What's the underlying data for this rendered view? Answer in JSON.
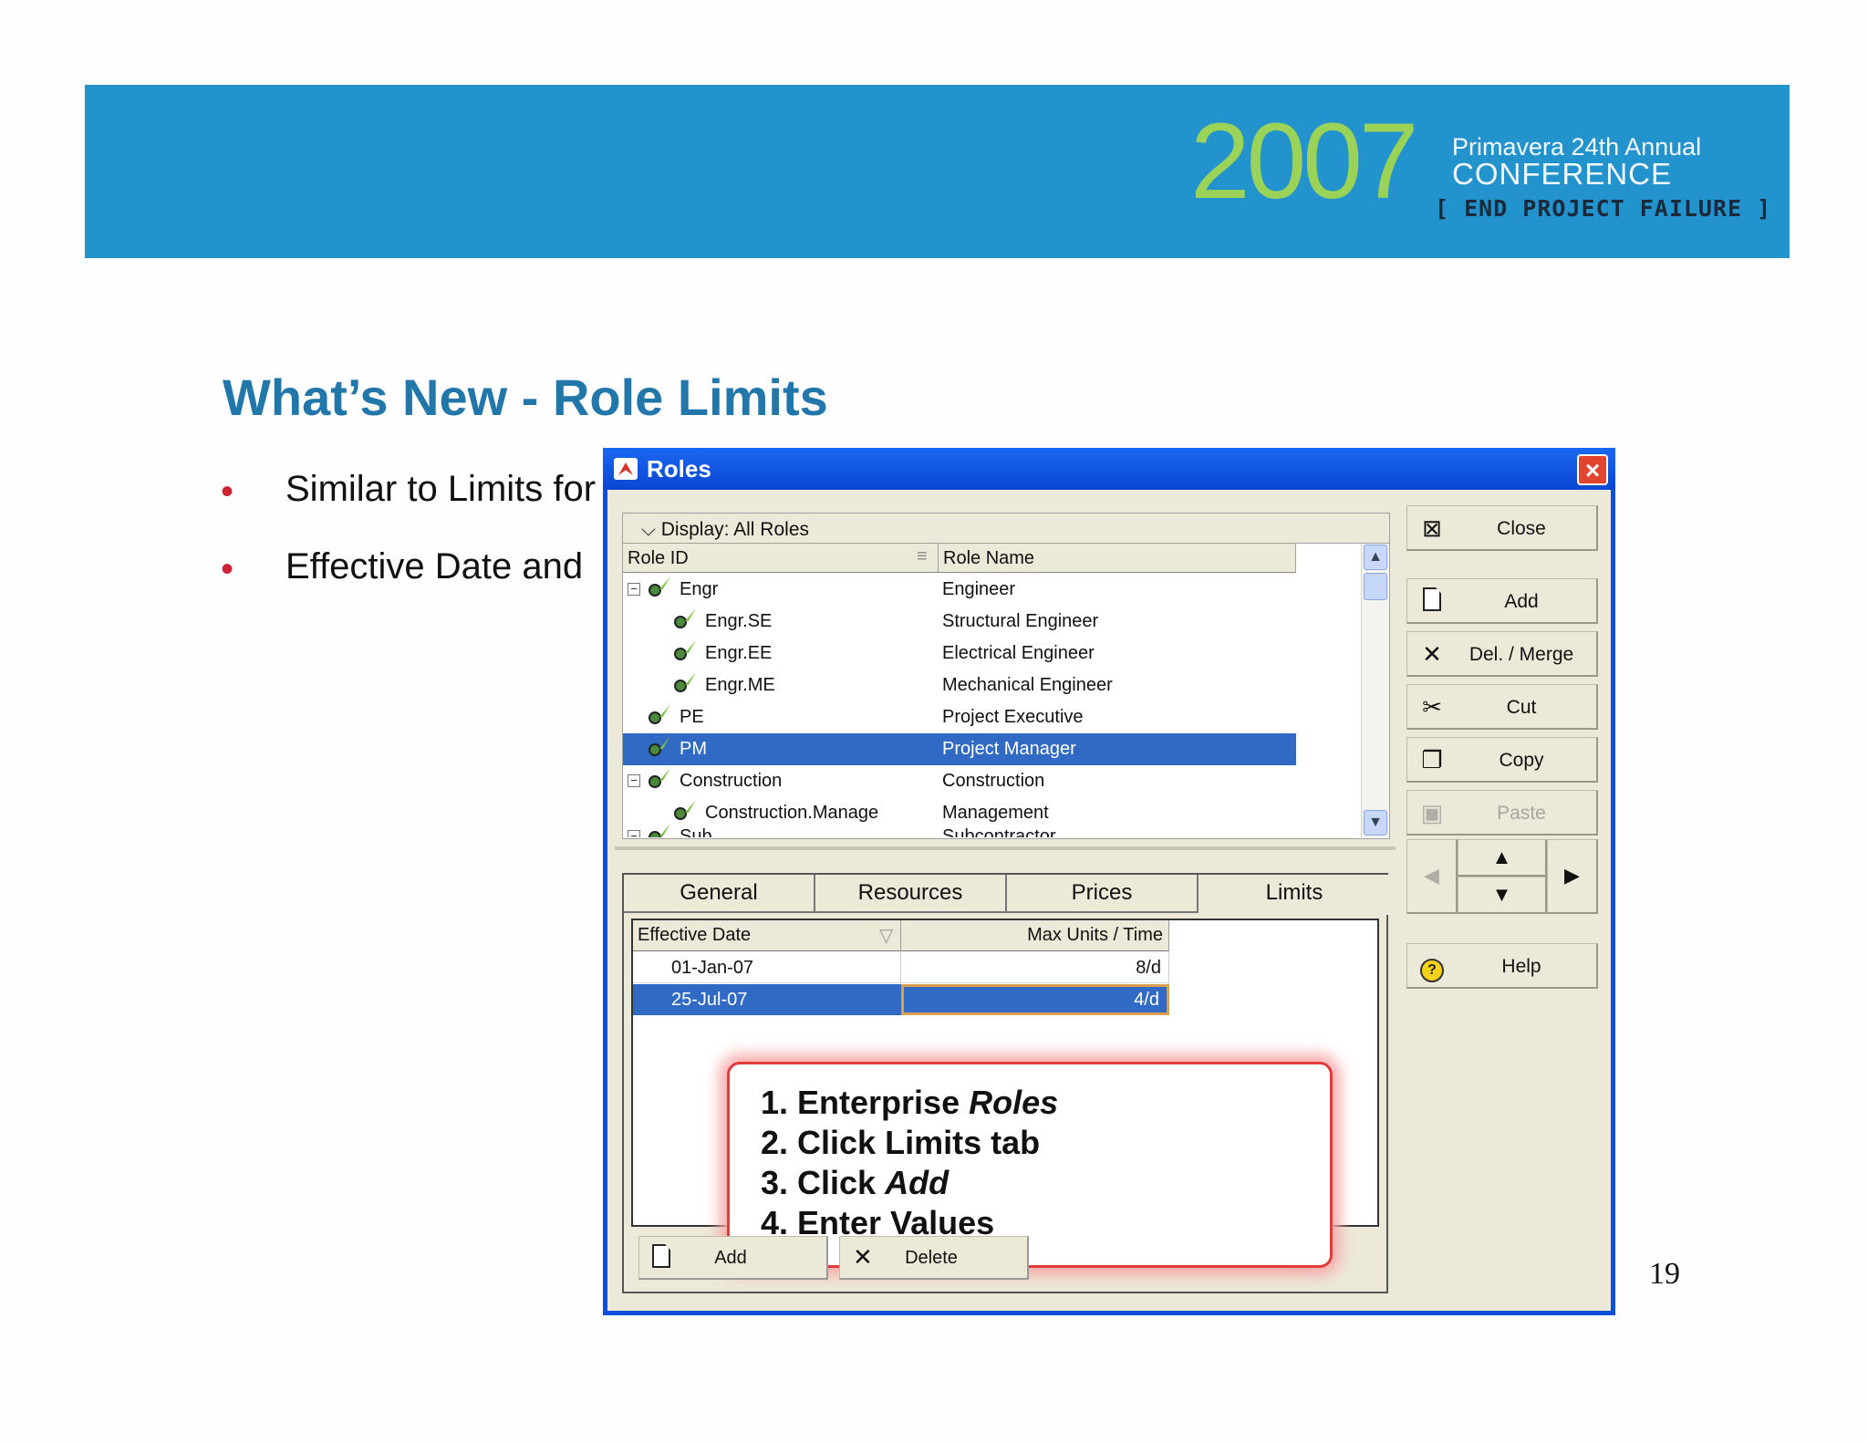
{
  "banner": {
    "year": "2007",
    "line1": "Primavera 24th Annual",
    "line2": "CONFERENCE",
    "line3": "[ END PROJECT FAILURE ]",
    "color": "#2393ce"
  },
  "slide": {
    "title": "What’s New - Role Limits",
    "bullets": [
      "Similar to Limits for",
      "Effective Date and"
    ],
    "page_number": "19"
  },
  "window": {
    "title": "Roles",
    "display_label": "Display: All Roles",
    "columns": {
      "role_id": "Role ID",
      "role_name": "Role Name"
    },
    "rows": [
      {
        "id": "Engr",
        "name": "Engineer",
        "expander": "−"
      },
      {
        "id": "Engr.SE",
        "name": "Structural Engineer"
      },
      {
        "id": "Engr.EE",
        "name": "Electrical Engineer"
      },
      {
        "id": "Engr.ME",
        "name": "Mechanical Engineer"
      },
      {
        "id": "PE",
        "name": "Project Executive"
      },
      {
        "id": "PM",
        "name": "Project Manager",
        "selected": true
      },
      {
        "id": "Construction",
        "name": "Construction",
        "expander": "−"
      },
      {
        "id": "Construction.Manage",
        "name": "Management"
      },
      {
        "id": "Sub",
        "name": "Subcontractor",
        "expander": "−"
      }
    ],
    "tabs": [
      "General",
      "Resources",
      "Prices",
      "Limits"
    ],
    "active_tab": "Limits",
    "limits_columns": {
      "effective_date": "Effective Date",
      "max_units": "Max Units / Time"
    },
    "limits_rows": [
      {
        "date": "01-Jan-07",
        "max": "8/d"
      },
      {
        "date": "25-Jul-07",
        "max": "4/d",
        "selected": true
      }
    ],
    "callout": [
      {
        "prefix": "1. Enterprise ",
        "em": "Roles"
      },
      {
        "prefix": "2. Click Limits tab",
        "em": ""
      },
      {
        "prefix": "3. Click ",
        "em": "Add"
      },
      {
        "prefix": "4. Enter Values",
        "em": ""
      }
    ],
    "bottom_buttons": {
      "add": "Add",
      "delete": "Delete"
    },
    "toolbar": {
      "close": "Close",
      "add": "Add",
      "del_merge": "Del. / Merge",
      "cut": "Cut",
      "copy": "Copy",
      "paste": "Paste",
      "help": "Help"
    },
    "selection_color": "#316ac5",
    "callout_border_color": "#e23b3b"
  }
}
